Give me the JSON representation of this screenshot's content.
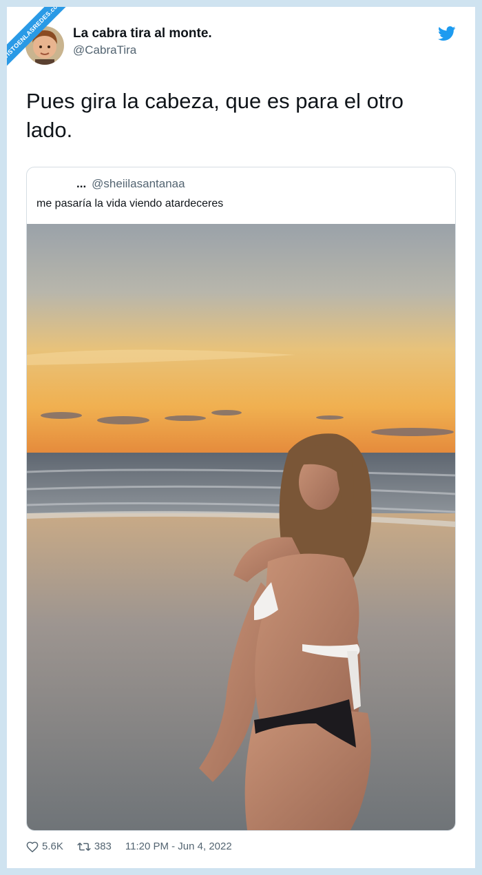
{
  "watermark": "VISTOENLASREDES.com",
  "author": {
    "display_name": "La cabra tira al monte.",
    "handle": "@CabraTira"
  },
  "icons": {
    "brand": "twitter-bird-icon",
    "like": "heart-icon",
    "retweet": "retweet-icon"
  },
  "colors": {
    "twitter_blue": "#1d9bf0",
    "text": "#0f1419",
    "muted": "#536471",
    "background": "#cfe3f0"
  },
  "tweet": {
    "text": "Pues gira la cabeza, que es para el otro lado."
  },
  "quoted_tweet": {
    "dots": "...",
    "handle": "@sheiilasantanaa",
    "text": "me pasaría la vida viendo atardeceres"
  },
  "stats": {
    "likes": "5.6K",
    "retweets": "383",
    "timestamp": "11:20 PM - Jun 4, 2022"
  }
}
